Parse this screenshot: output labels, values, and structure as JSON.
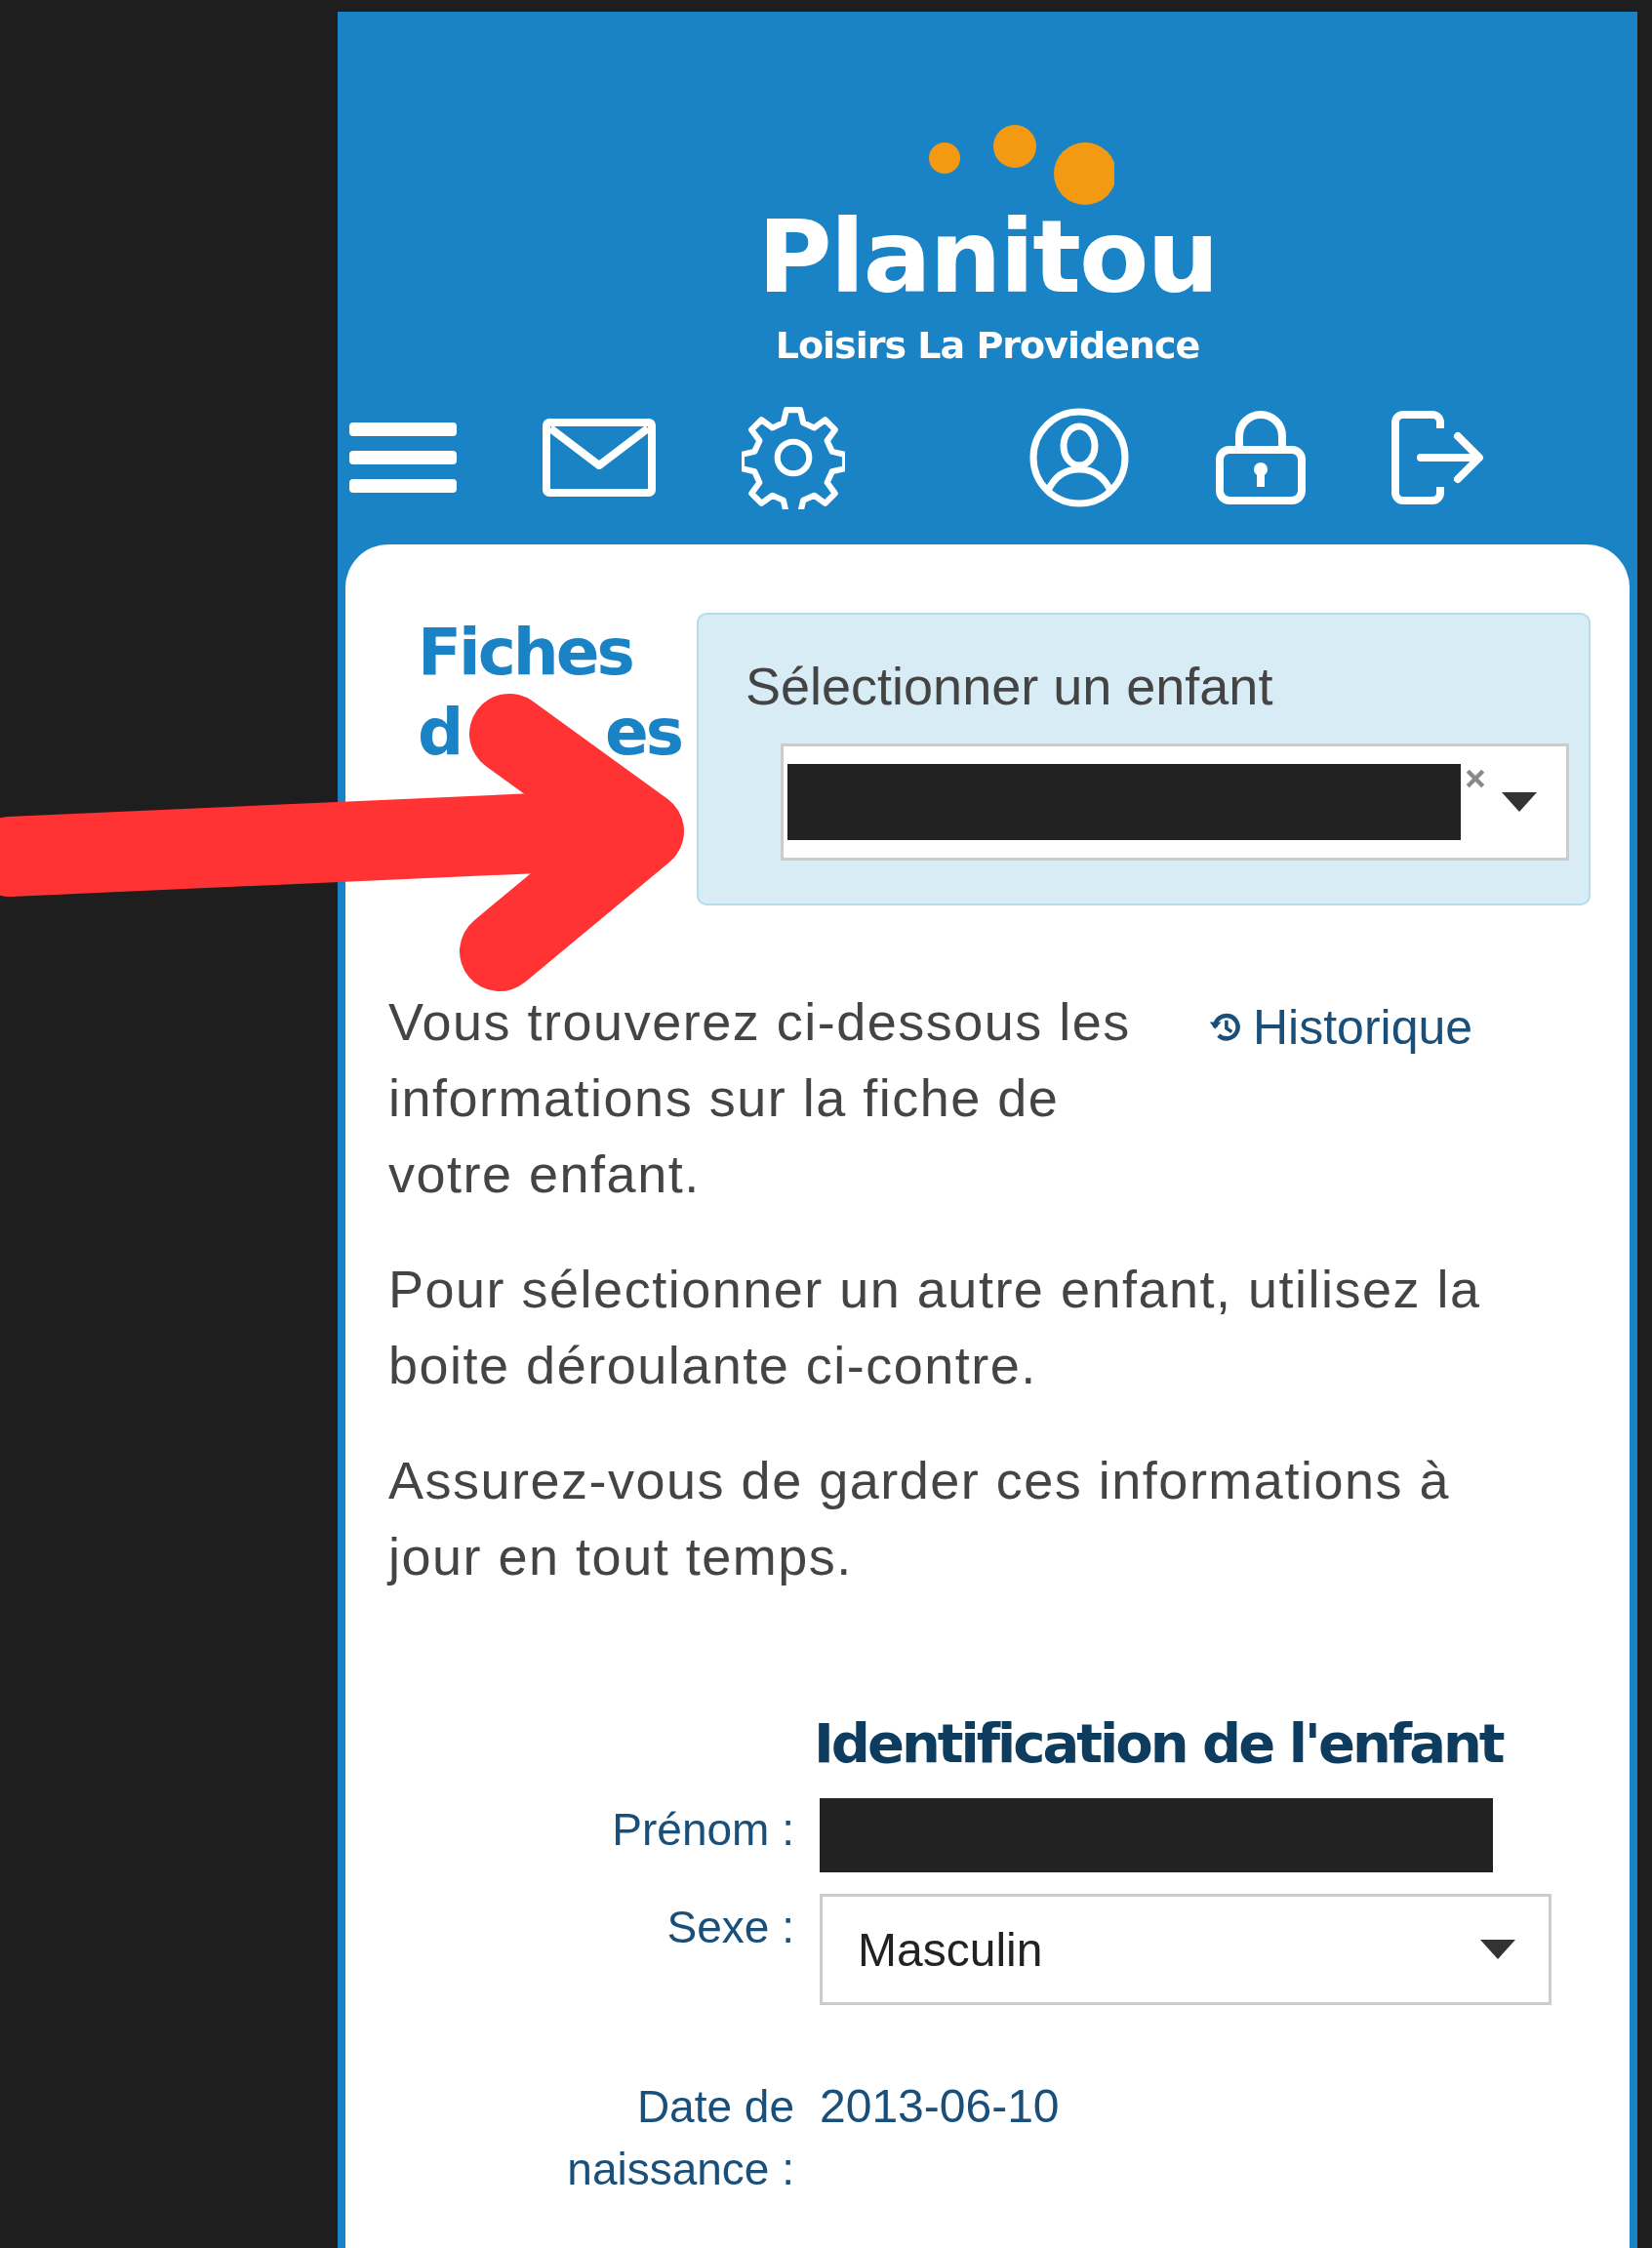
{
  "header": {
    "logo": "Planitou",
    "subtitle": "Loisirs La Providence",
    "toolbar": [
      {
        "kind": "menu"
      },
      {
        "kind": "mail"
      },
      {
        "kind": "settings"
      },
      {
        "kind": "account"
      },
      {
        "kind": "lock"
      },
      {
        "kind": "logout"
      }
    ]
  },
  "title_fragments": [
    "Fiches",
    "d",
    "es"
  ],
  "child_select": {
    "label": "Sélectionner un enfant",
    "clearable": true
  },
  "history_link": "Historique",
  "paragraphs": [
    "Vous trouverez ci-dessous les informations sur la fiche de votre enfant.",
    "Pour sélectionner un autre enfant, utilisez la boite déroulante ci-contre.",
    "Assurez-vous de garder ces informations à jour en tout temps."
  ],
  "identification": {
    "heading": "Identification de l'enfant",
    "fields": [
      {
        "kind": "redacted",
        "label": "Prénom :"
      },
      {
        "kind": "select",
        "label": "Sexe :",
        "value": "Masculin"
      },
      {
        "kind": "text",
        "label": "Date de naissance :",
        "value": "2013-06-10"
      }
    ]
  }
}
